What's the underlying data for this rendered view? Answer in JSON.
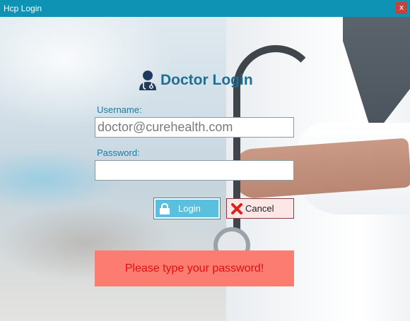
{
  "window": {
    "title": "Hcp Login",
    "close_glyph": "x"
  },
  "login": {
    "heading": "Doctor Login",
    "heading_icon": "doctor-icon",
    "username_label": "Username:",
    "username_value": "doctor@curehealth.com",
    "password_label": "Password:",
    "password_value": ""
  },
  "buttons": {
    "login_label": "Login",
    "login_icon": "lock-icon",
    "cancel_label": "Cancel",
    "cancel_icon": "x-icon"
  },
  "message": {
    "text": "Please type your password!"
  },
  "colors": {
    "titlebar": "#0f93b5",
    "heading": "#1e6f93",
    "label": "#1e7aa3",
    "login_button": "#5bc0de",
    "error_bg": "#fc7c72",
    "error_text": "#e01010"
  }
}
